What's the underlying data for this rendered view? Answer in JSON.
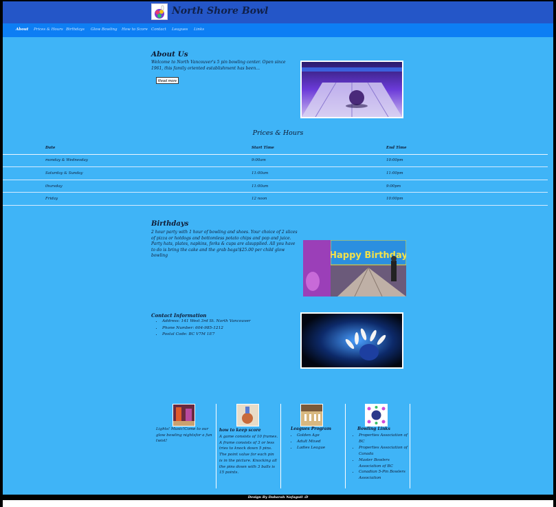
{
  "brand": {
    "title": "North Shore Bowl"
  },
  "nav": {
    "items": [
      "About",
      "Prices & Hours",
      "Birthdays",
      "Glow Bowling",
      "How to Score",
      "Contact",
      "Leagues",
      "Links"
    ],
    "active": "About"
  },
  "about": {
    "title": "About Us",
    "text": "Welcome to North Vancouver's 5 pin bowling center. Open since 1961, this family oriented establishment has been...",
    "button": "Read more"
  },
  "prices_hours": {
    "title": "Prices & Hours",
    "columns": [
      "Date",
      "Start Time",
      "End Time"
    ],
    "rows": [
      [
        "monday & Wednesday",
        "9:00am",
        "10:00pm"
      ],
      [
        "Saturday & Sunday",
        "11:00am",
        "11:00pm"
      ],
      [
        "thursday",
        "11:00am",
        "9:00pm"
      ],
      [
        "Friday",
        "12 noon",
        "10:00pm"
      ]
    ]
  },
  "birthdays": {
    "title": "Birthdays",
    "text": "2 hour party with 1 hour of bowling and shoes. Your choice of 2 slices of pizza or hotdogs and bottomless potato chips and pop and juice. Party hats, plates, napkins, forks & cups are alsupplied. All you have to do is bring the cake and the grab bags!$25.00 per child glow bowling",
    "banner_text": "Happy Birthday"
  },
  "contact": {
    "title": "Contact Information",
    "items": [
      "Address: 141 West 3rd St. North Vancouver",
      "Phone Number: 604-985-1212",
      "Postal Code: BC V7M 1E7"
    ]
  },
  "footer": {
    "glow_text": "Lights! Music!Come to our glow bowling nightsfor a fun twist!",
    "score": {
      "heading": "how to keep score",
      "text": "A game consists of 10 frames. A frame consists of 3 or less tries to knock down 5 pins. The point value for each pin is in the picture. Knocking all the pins down with 3 balls is 15 points."
    },
    "leagues": {
      "heading": "Leagues Program",
      "items": [
        "Golden Age",
        "Adult Mixed",
        "Ladies League"
      ]
    },
    "links": {
      "heading": "Bowling Links",
      "items": [
        "Properties Association of BC",
        "Properties Association of Canada",
        "Master Bowlers Association of BC",
        "Canadian 5-Pin Bowlers Association"
      ]
    },
    "credit": "Design By Dabarah Nafaguil :D"
  },
  "colors": {
    "page_bg": "#3fb4f7",
    "brand_bar": "#2456c8",
    "nav_bar": "#0d7ef4",
    "text": "#0e1a33"
  }
}
